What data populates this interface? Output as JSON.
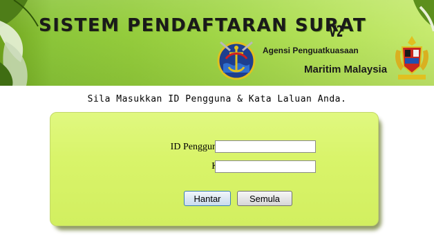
{
  "header": {
    "title": "SISTEM PENDAFTARAN SURAT",
    "version": "V2",
    "agency_line1": "Agensi Penguatkuasaan",
    "agency_line2": "Maritim Malaysia"
  },
  "instruction": "Sila Masukkan ID Pengguna & Kata Laluan Anda.",
  "login": {
    "id_label": "ID Pengguna (No. KP)",
    "id_value": "",
    "password_label": "Kata Laluan",
    "password_value": "",
    "submit_label": "Hantar",
    "reset_label": "Semula"
  },
  "colors": {
    "banner": "#94cc3c",
    "panel": "#d9f46a"
  }
}
